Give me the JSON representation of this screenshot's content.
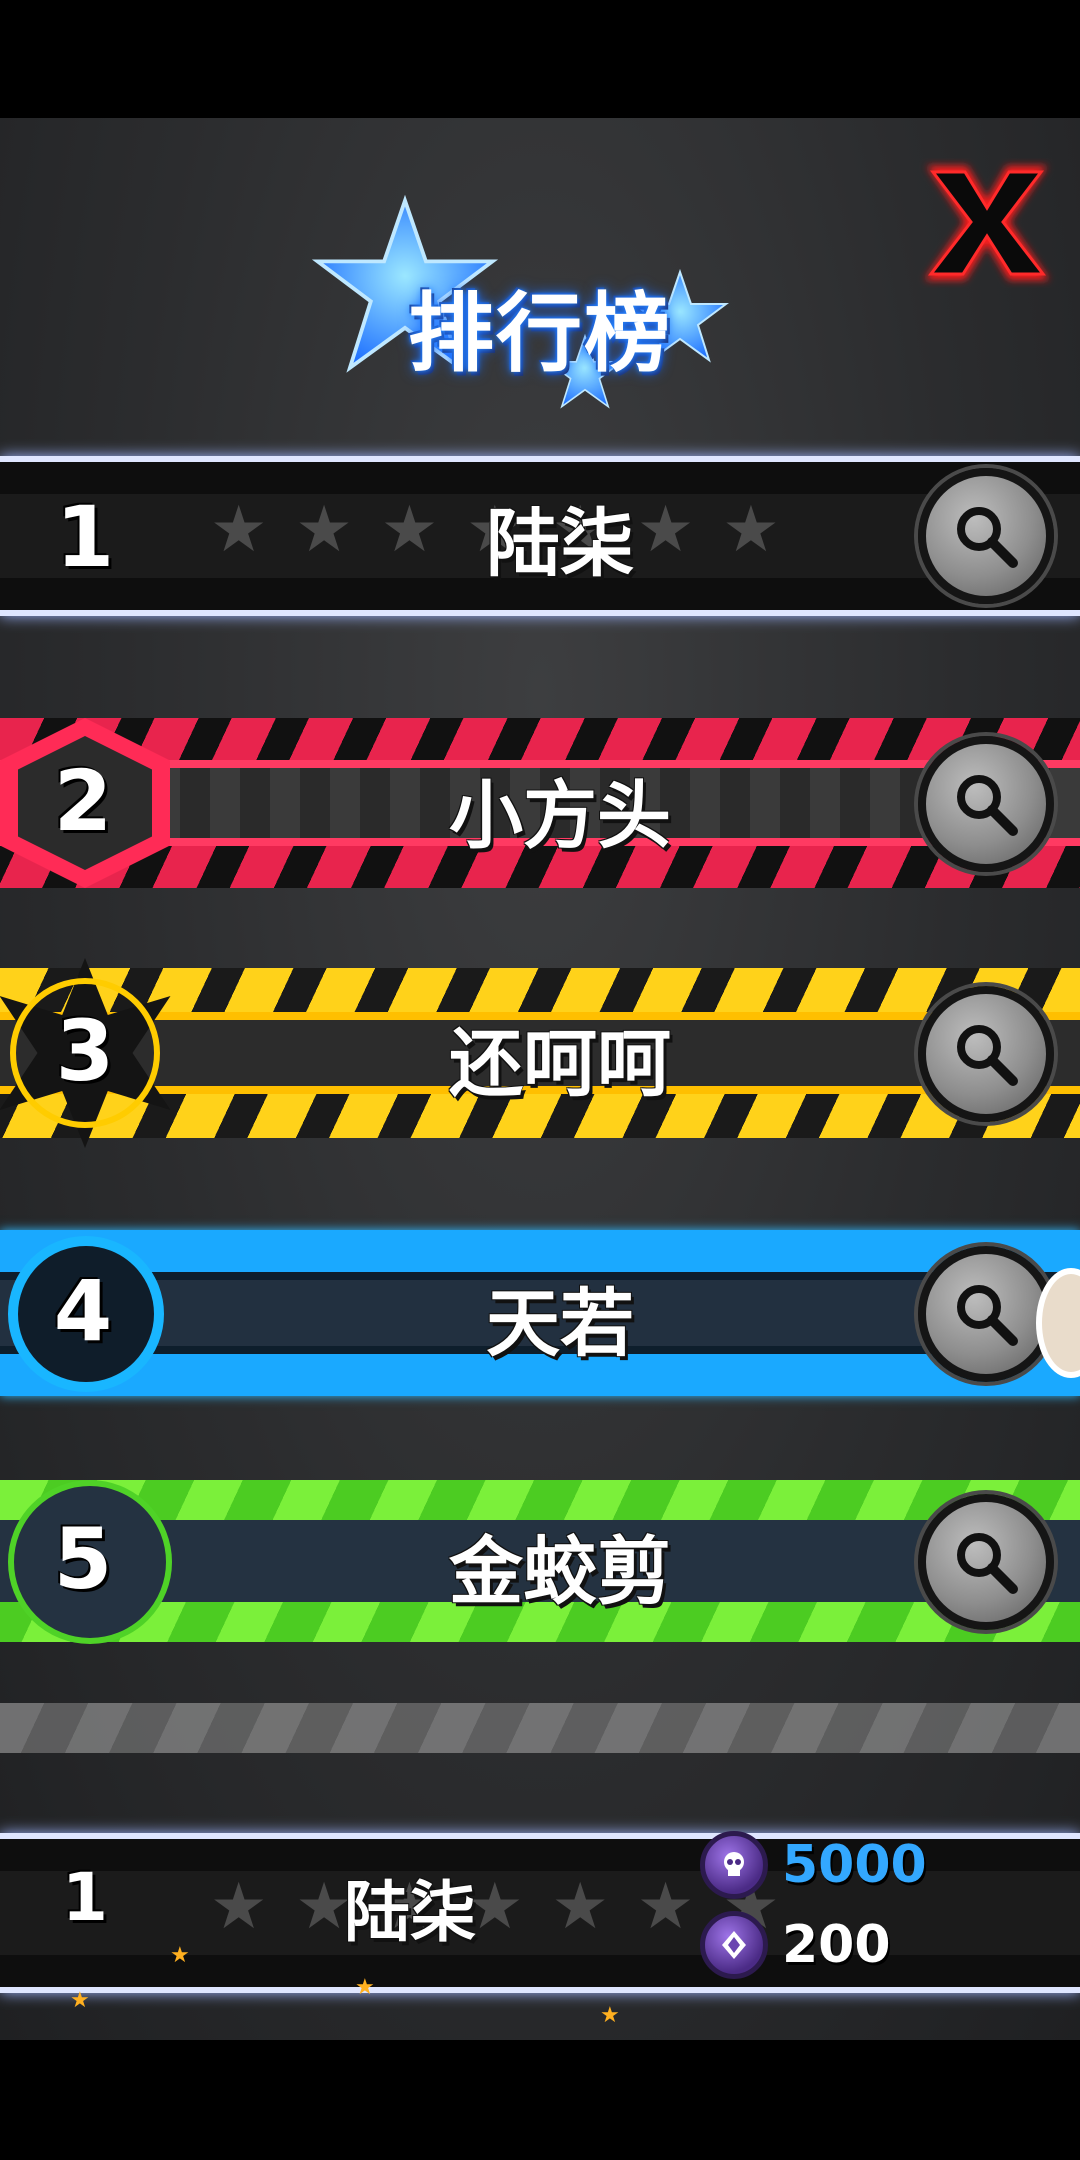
{
  "title": "排行榜",
  "close_label": "X",
  "rows": [
    {
      "rank": "1",
      "name": "陆柒"
    },
    {
      "rank": "2",
      "name": "小方头"
    },
    {
      "rank": "3",
      "name": "还呵呵"
    },
    {
      "rank": "4",
      "name": "天若"
    },
    {
      "rank": "5",
      "name": "金蛟剪"
    }
  ],
  "me": {
    "rank": "1",
    "name": "陆柒",
    "score": "5000",
    "gems": "200"
  },
  "colors": {
    "row1": "#0e0e0e",
    "row2": "#e8244d",
    "row3": "#ffd21a",
    "row4": "#1aa9ff",
    "row5": "#7bf03a",
    "close": "#ff1a1a",
    "score": "#33a8ff"
  },
  "icons": {
    "zoom": "magnifier-icon",
    "close": "close-icon",
    "score": "skull-coin-icon",
    "gems": "gem-coin-icon",
    "title_decor": "star-icon"
  }
}
